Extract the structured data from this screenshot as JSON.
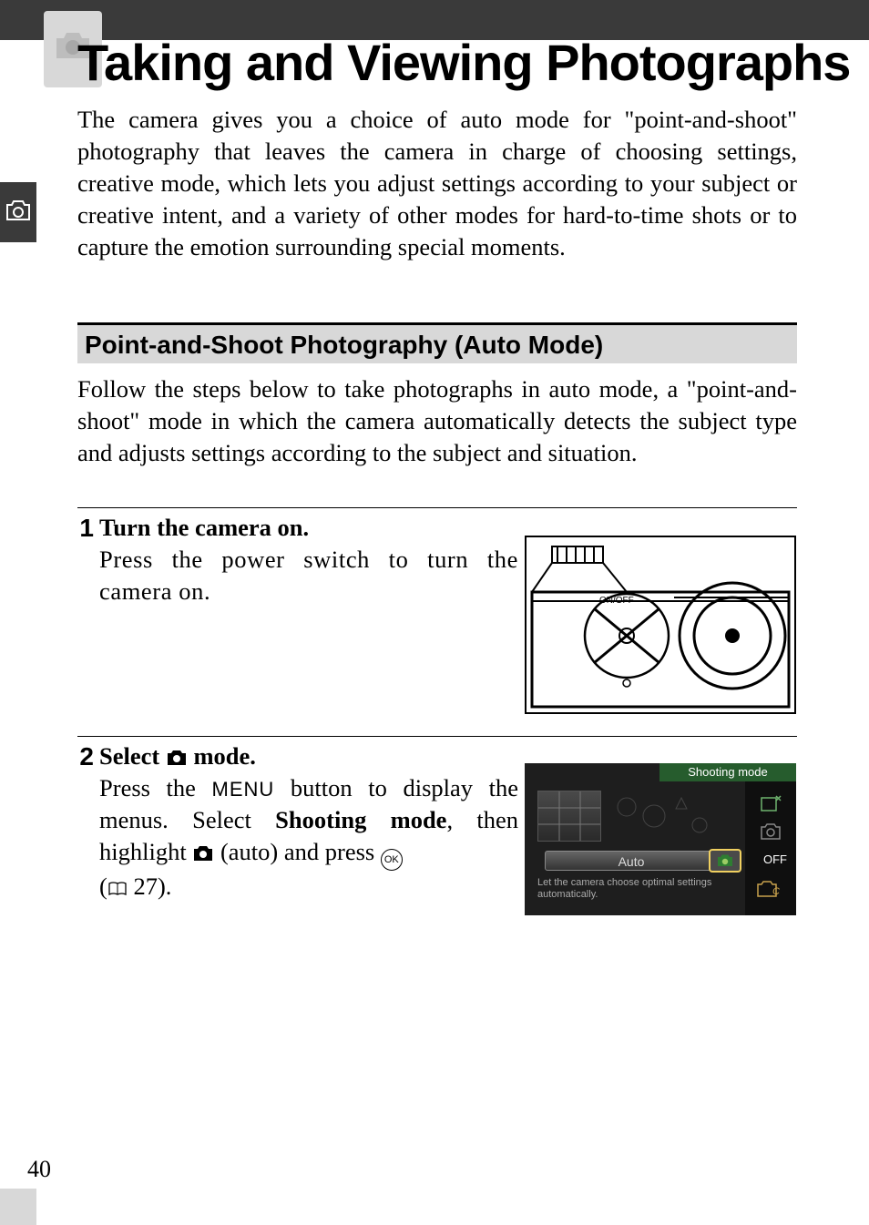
{
  "chapter": {
    "title": "Taking and Viewing Photographs",
    "icon_name": "camera-icon"
  },
  "intro": "The camera gives you a choice of auto mode for \"point-and-shoot\" photography that leaves the camera in charge of choosing settings, creative mode, which lets you adjust settings according to your subject or creative intent, and a variety of other modes for hard-to-time shots or to capture the emotion surrounding special moments.",
  "section": {
    "heading": "Point-and-Shoot Photography (Auto Mode)",
    "intro": "Follow the steps below to take photographs in auto mode, a \"point-and-shoot\" mode in which the camera automatically detects the subject type and adjusts settings according to the subject and situation."
  },
  "steps": [
    {
      "number": "1",
      "title": "Turn the camera on.",
      "body": "Press the power switch to turn the camera on.",
      "figure": {
        "power_label": "ON/OFF"
      }
    },
    {
      "number": "2",
      "title_prefix": "Select ",
      "title_suffix": " mode.",
      "body_parts": {
        "p1": "Press the ",
        "menu_label": "MENU",
        "p2": " button to display the menus. Select ",
        "bold": "Shooting mode",
        "p3": ", then highlight ",
        "auto_word": " (auto) and press ",
        "ok_label": "OK",
        "ref_open": "(",
        "ref_page": " 27).",
        "book_icon": "book-icon"
      },
      "figure": {
        "header": "Shooting mode",
        "auto_label": "Auto",
        "off_label": "OFF",
        "desc": "Let the camera choose optimal settings automatically."
      }
    }
  ],
  "page_number": "40"
}
